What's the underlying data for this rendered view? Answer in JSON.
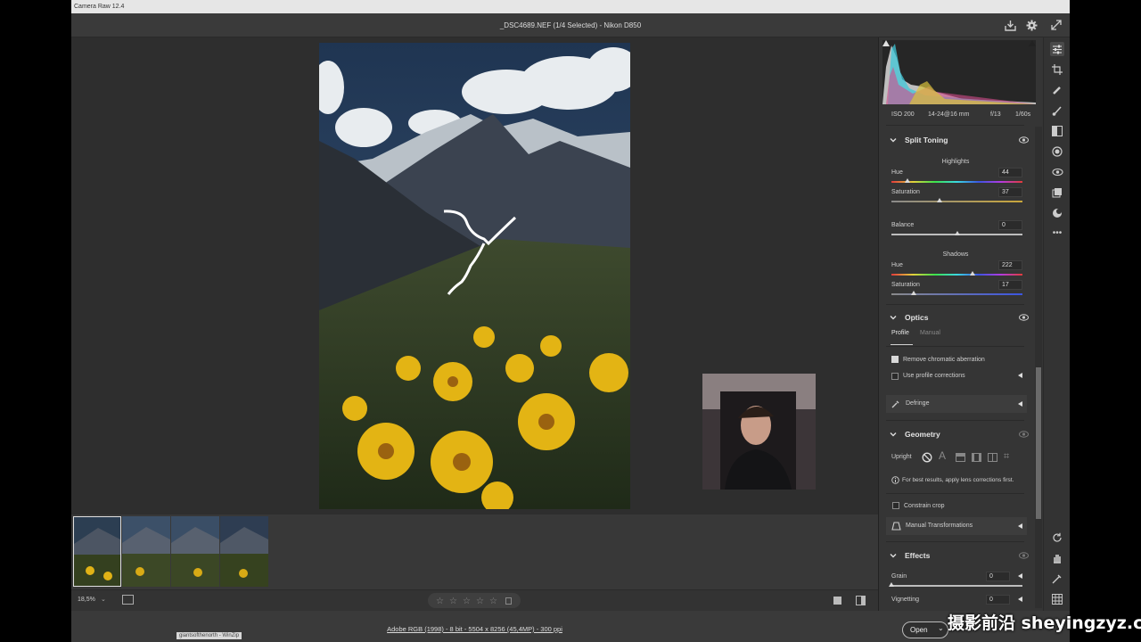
{
  "app": {
    "title": "Camera Raw 12.4"
  },
  "header": {
    "file_title": "_DSC4689.NEF (1/4 Selected)  -  Nikon D850"
  },
  "camera_info": {
    "iso": "ISO 200",
    "lens": "14-24@16 mm",
    "aperture": "f/13",
    "shutter": "1/60s"
  },
  "split_toning": {
    "title": "Split Toning",
    "highlights_label": "Highlights",
    "highlights_hue_label": "Hue",
    "highlights_hue_value": "44",
    "highlights_hue_level": 0.12,
    "highlights_sat_label": "Saturation",
    "highlights_sat_value": "37",
    "highlights_sat_level": 0.37,
    "balance_label": "Balance",
    "balance_value": "0",
    "balance_level": 0.5,
    "shadows_label": "Shadows",
    "shadows_hue_label": "Hue",
    "shadows_hue_value": "222",
    "shadows_hue_level": 0.62,
    "shadows_sat_label": "Saturation",
    "shadows_sat_value": "17",
    "shadows_sat_level": 0.17
  },
  "optics": {
    "title": "Optics",
    "tab_profile": "Profile",
    "tab_manual": "Manual",
    "remove_ca_label": "Remove chromatic aberration",
    "remove_ca_checked": true,
    "profile_corr_label": "Use profile corrections",
    "profile_corr_checked": false,
    "defringe_label": "Defringe"
  },
  "geometry": {
    "title": "Geometry",
    "upright_label": "Upright",
    "hint": "For best results, apply lens corrections first.",
    "constrain_label": "Constrain crop",
    "manual_label": "Manual Transformations"
  },
  "effects": {
    "title": "Effects",
    "grain_label": "Grain",
    "grain_value": "0",
    "vignetting_label": "Vignetting",
    "vignetting_value": "0"
  },
  "bottom": {
    "zoom": "18,5%",
    "hover_tooltip": "giantsofthenorth - WinZip"
  },
  "status": {
    "workflow": "Adobe RGB (1998) - 8 bit - 5504 x 8256 (45,4MP) - 300 ppi",
    "open_label": "Open"
  },
  "watermark": {
    "text": "摄影前沿 sheyingzyz.com"
  }
}
